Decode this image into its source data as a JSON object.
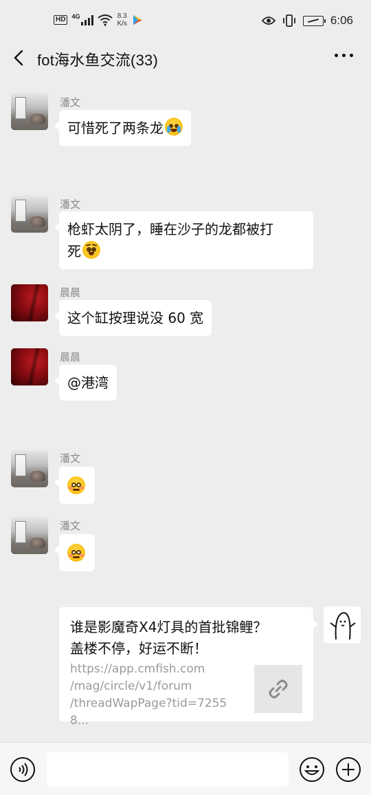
{
  "status_bar": {
    "hd": "HD",
    "network": "4G",
    "speed_value": "8.3",
    "speed_unit": "K/s",
    "time": "6:06"
  },
  "header": {
    "title": "fot海水鱼交流(33)"
  },
  "messages": [
    {
      "sender": "潘文",
      "avatar": "fish-tank-avatar",
      "text": "可惜死了两条龙",
      "emoji": "crying-face"
    },
    {
      "sender": "潘文",
      "avatar": "fish-tank-avatar",
      "text_line1": "枪虾太阴了，睡在沙子的龙都被打",
      "text_line2": "死",
      "emoji": "pleading-face"
    },
    {
      "sender": "晨晨",
      "avatar": "red-avatar",
      "text": "这个缸按理说没 60 宽"
    },
    {
      "sender": "晨晨",
      "avatar": "red-avatar",
      "text": "@港湾"
    },
    {
      "sender": "潘文",
      "avatar": "fish-tank-avatar",
      "emoji": "flushed-face"
    },
    {
      "sender": "潘文",
      "avatar": "fish-tank-avatar",
      "emoji": "flushed-face"
    }
  ],
  "link_card": {
    "title_line1": "谁是影魔奇X4灯具的首批锦鲤？",
    "title_line2": "盖楼不停，好运不断！",
    "url_line1": "https://app.cmfish.com",
    "url_line2": "/mag/circle/v1/forum",
    "url_line3": "/threadWapPage?tid=72558..."
  },
  "input_bar": {
    "placeholder": ""
  },
  "colors": {
    "background": "#ededed",
    "bubble": "#ffffff",
    "sender_name": "#8a8a8a",
    "url_text": "#9a9a9a"
  }
}
